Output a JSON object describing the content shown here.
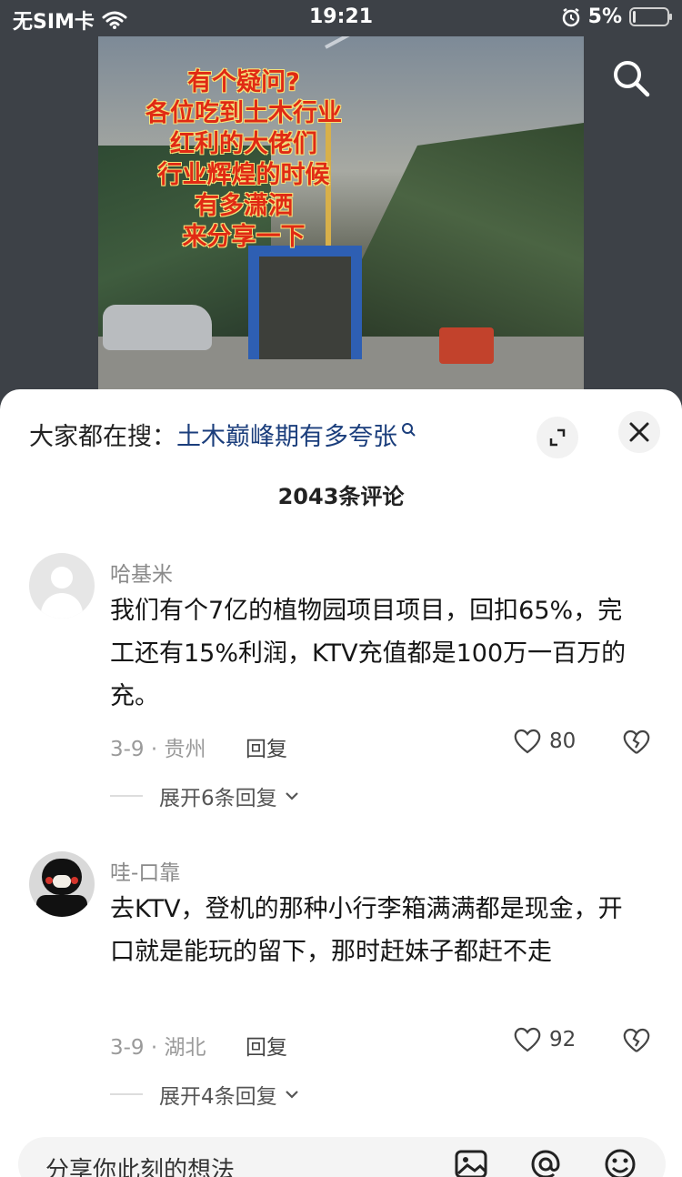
{
  "status_bar": {
    "carrier": "无SIM卡",
    "time": "19:21",
    "battery_percent": "5%"
  },
  "video": {
    "caption_lines": [
      "有个疑问?",
      "各位吃到土木行业",
      "红利的大佬们",
      "行业辉煌的时候",
      "有多潇洒",
      "来分享一下"
    ]
  },
  "comment_sheet": {
    "hot_search_prefix": "大家都在搜：",
    "hot_search_query": "土木巅峰期有多夸张",
    "comment_count": "2043条评论",
    "comments": [
      {
        "username": "哈基米",
        "text": "我们有个7亿的植物园项目项目，回扣65%，完工还有15%利润，KTV充值都是100万一百万的充。",
        "meta": "3-9 · 贵州",
        "reply_label": "回复",
        "likes": "80",
        "expand_label": "展开6条回复"
      },
      {
        "username": "哇-口靠",
        "text": "去KTV，登机的那种小行李箱满满都是现金，开口就是能玩的留下，那时赶妹子都赶不走",
        "meta": "3-9 · 湖北",
        "reply_label": "回复",
        "likes": "92",
        "expand_label": "展开4条回复"
      }
    ],
    "input_placeholder": "分享你此刻的想法"
  },
  "icons": {
    "wifi": "wifi-icon",
    "alarm": "alarm-icon",
    "battery": "battery-icon",
    "search": "search-icon",
    "expand": "expand-icon",
    "close": "close-icon",
    "heart": "heart-icon",
    "dislike": "broken-heart-icon",
    "chevron": "chevron-down-icon",
    "image": "image-icon",
    "at": "at-icon",
    "emoji": "emoji-icon"
  },
  "colors": {
    "link": "#1b3e7c",
    "caption_red": "#e02a14",
    "sheet_bg": "#ffffff"
  }
}
